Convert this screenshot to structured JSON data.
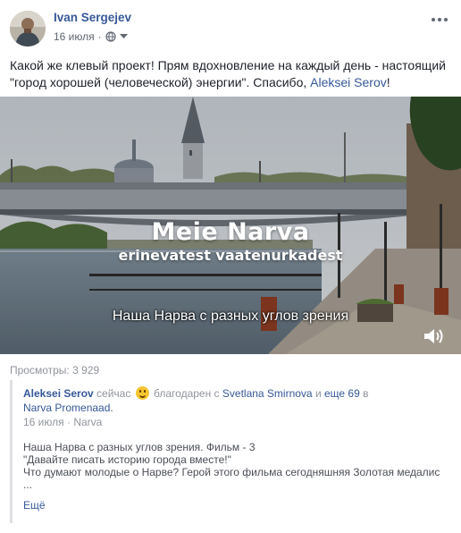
{
  "post": {
    "author": "Ivan Sergejev",
    "date": "16 июля",
    "privacy_icon": "globe-icon",
    "text_main": "Какой же клевый проект! Прям вдохновление на каждый день - настоящий \"город хорошей (человеческой) энергии\". Спасибо, ",
    "text_link": "Aleksei Serov",
    "text_end": "!"
  },
  "video": {
    "title_line1": "Meie Narva",
    "title_line2": "erinevatest vaatenurkadest",
    "subtitle": "Наша Нарва с разных углов зрения",
    "sound_icon": "speaker-icon"
  },
  "stats": {
    "views": "Просмотры: 3 929"
  },
  "shared": {
    "author": "Aleksei Serov",
    "now": " сейчас ",
    "feeling": " благодарен с ",
    "tagged": "Svetlana Smirnova",
    "and": " и ",
    "others": "еще 69",
    "in": " в ",
    "place": "Narva Promenaad",
    "dot": ".",
    "date": "16 июля",
    "sep": "·",
    "location": "Narva",
    "desc_line1": "Наша Нарва с разных углов зрения. Фильм - 3",
    "desc_line2": "\"Давайте писать историю города вместе!\"",
    "desc_line3": "Что думают молодые о Нарве? Герой этого фильма сегодняшняя Золотая медалис",
    "desc_ellipsis": "...",
    "more": "Ещё"
  },
  "colors": {
    "link": "#365899",
    "text": "#1d2129",
    "secondary": "#616770",
    "muted": "#90949c"
  }
}
